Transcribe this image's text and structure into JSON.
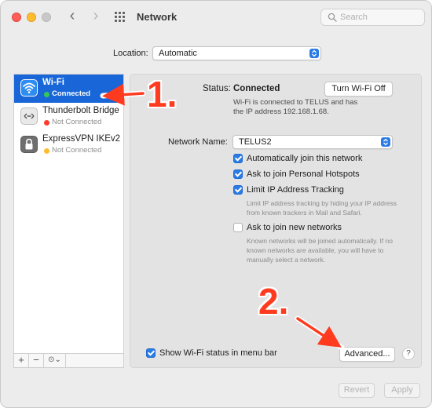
{
  "window": {
    "title": "Network",
    "search_placeholder": "Search"
  },
  "location": {
    "label": "Location:",
    "value": "Automatic"
  },
  "services": [
    {
      "name": "Wi-Fi",
      "status": "Connected",
      "status_color": "#34c759",
      "icon": "wifi-icon",
      "selected": true
    },
    {
      "name": "Thunderbolt Bridge",
      "status": "Not Connected",
      "status_color": "#ff3b30",
      "icon": "thunderbolt-bridge-icon",
      "selected": false
    },
    {
      "name": "ExpressVPN IKEv2",
      "status": "Not Connected",
      "status_color": "#febc2e",
      "icon": "lock-icon",
      "selected": false
    }
  ],
  "sidebar_toolbar": {
    "add": "+",
    "remove": "−",
    "action": "⊙⌄"
  },
  "detail": {
    "status_label": "Status:",
    "status_value": "Connected",
    "status_desc": "Wi-Fi is connected to TELUS and has the IP address 192.168.1.68.",
    "turn_off_button": "Turn Wi-Fi Off",
    "network_name_label": "Network Name:",
    "network_name_value": "TELUS2",
    "auto_join": {
      "label": "Automatically join this network",
      "checked": true
    },
    "ask_hotspots": {
      "label": "Ask to join Personal Hotspots",
      "checked": true
    },
    "limit_ip": {
      "label": "Limit IP Address Tracking",
      "checked": true
    },
    "limit_ip_help": "Limit IP address tracking by hiding your IP address from known trackers in Mail and Safari.",
    "ask_new": {
      "label": "Ask to join new networks",
      "checked": false
    },
    "ask_new_help": "Known networks will be joined automatically. If no known networks are available, you will have to manually select a network.",
    "show_status": {
      "label": "Show Wi-Fi status in menu bar",
      "checked": true
    },
    "advanced_button": "Advanced...",
    "help_button": "?"
  },
  "footer": {
    "revert": "Revert",
    "apply": "Apply"
  },
  "annotations": {
    "step1": "1.",
    "step2": "2."
  },
  "colors": {
    "accent": "#2a7be6",
    "selection": "#1866d8",
    "annotation": "#ff3b1f"
  }
}
